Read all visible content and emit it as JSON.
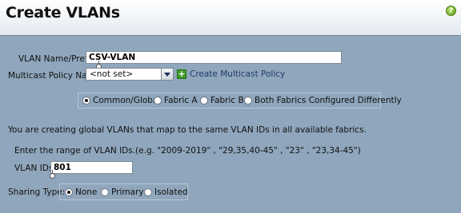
{
  "header": {
    "title": "Create VLANs",
    "help_icon": "help-icon",
    "help_glyph": "?"
  },
  "form": {
    "vlan_name_label": "VLAN Name/Prefix:",
    "vlan_name_value": "CSV-VLAN",
    "multicast_label": "Multicast Policy Name:",
    "multicast_value": "<not set>",
    "create_multicast_link": "Create Multicast Policy",
    "plus_glyph": "+",
    "fabric_options": [
      {
        "label": "Common/Global",
        "selected": true
      },
      {
        "label": "Fabric A",
        "selected": false
      },
      {
        "label": "Fabric B",
        "selected": false
      },
      {
        "label": "Both Fabrics Configured Differently",
        "selected": false
      }
    ],
    "info_text": "You are creating global VLANs that map to the same VLAN IDs in all available fabrics.",
    "range_hint": "Enter the range of VLAN IDs.(e.g. \"2009-2019\" , \"29,35,40-45\" , \"23\" , \"23,34-45\")",
    "vlan_ids_label": "VLAN IDs:",
    "vlan_ids_value": "801",
    "sharing_label": "Sharing Type:",
    "sharing_options": [
      {
        "label": "None",
        "selected": true
      },
      {
        "label": "Primary",
        "selected": false
      },
      {
        "label": "Isolated",
        "selected": false
      }
    ]
  },
  "colors": {
    "background": "#8fa6bc",
    "link": "#213a6b",
    "plus_green": "#3d9a2a"
  }
}
